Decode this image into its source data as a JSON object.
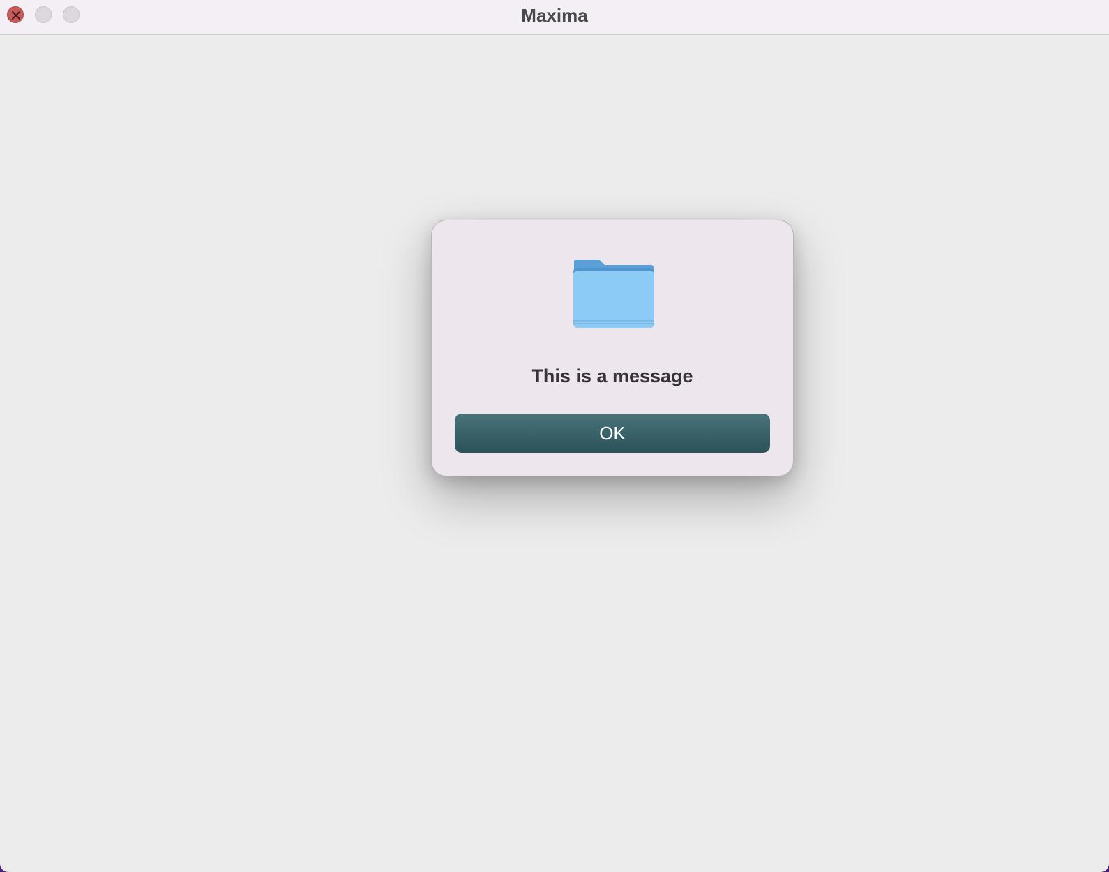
{
  "window": {
    "title": "Maxima"
  },
  "dialog": {
    "icon": "folder-icon",
    "message": "This is a message",
    "ok_label": "OK"
  },
  "colors": {
    "button_primary": "#2f565e",
    "close_button": "#c45a5a",
    "folder": "#8ccbf5"
  }
}
